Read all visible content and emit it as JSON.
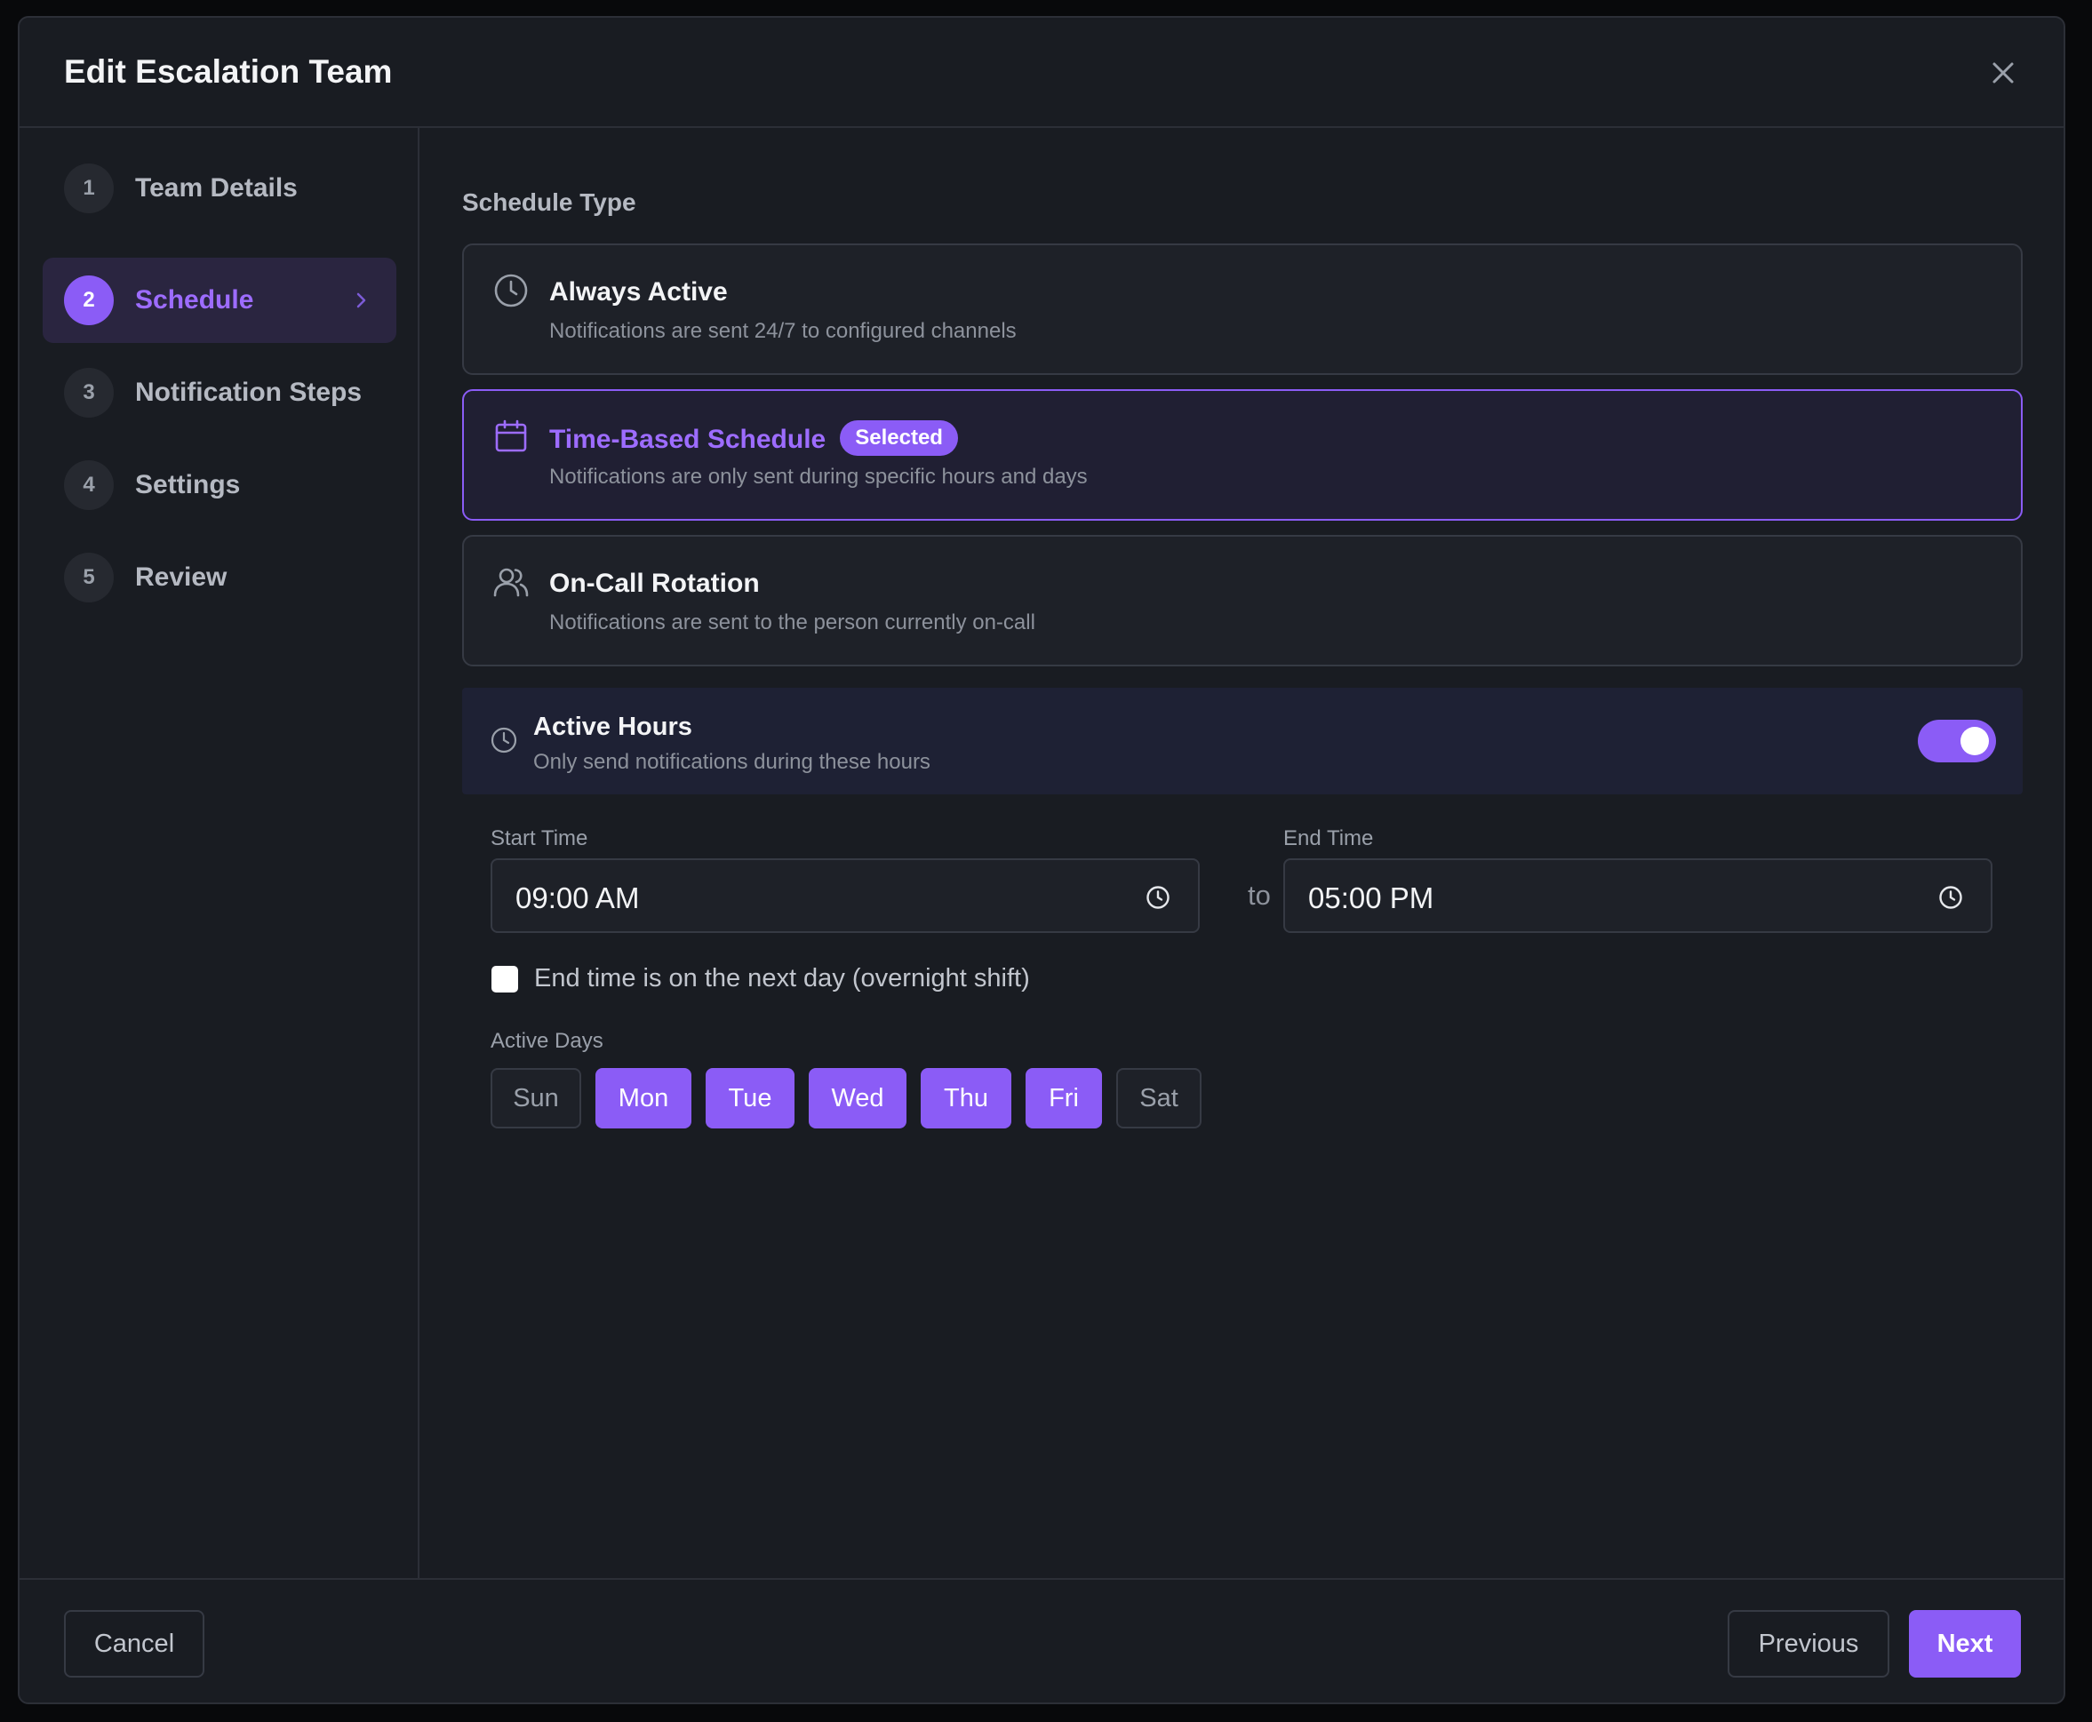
{
  "dialog": {
    "title": "Edit Escalation Team"
  },
  "steps": [
    {
      "num": "1",
      "label": "Team Details"
    },
    {
      "num": "2",
      "label": "Schedule"
    },
    {
      "num": "3",
      "label": "Notification Steps"
    },
    {
      "num": "4",
      "label": "Settings"
    },
    {
      "num": "5",
      "label": "Review"
    }
  ],
  "active_step": "2",
  "schedule": {
    "section_title": "Schedule Type",
    "options": [
      {
        "name": "Always Active",
        "desc": "Notifications are sent 24/7 to configured channels",
        "icon": "clock-icon"
      },
      {
        "name": "Time-Based Schedule",
        "desc": "Notifications are only sent during specific hours and days",
        "icon": "calendar-icon",
        "badge": "Selected"
      },
      {
        "name": "On-Call Rotation",
        "desc": "Notifications are sent to the person currently on-call",
        "icon": "users-icon"
      }
    ],
    "selected": "Time-Based Schedule"
  },
  "active_hours": {
    "title": "Active Hours",
    "desc": "Only send notifications during these hours",
    "enabled": true
  },
  "time": {
    "start_label": "Start Time",
    "start_value": "09:00 AM",
    "separator": "to",
    "end_label": "End Time",
    "end_value": "05:00 PM"
  },
  "overnight": {
    "label": "End time is on the next day (overnight shift)",
    "checked": false
  },
  "days": {
    "label": "Active Days",
    "items": [
      {
        "label": "Sun",
        "active": false
      },
      {
        "label": "Mon",
        "active": true
      },
      {
        "label": "Tue",
        "active": true
      },
      {
        "label": "Wed",
        "active": true
      },
      {
        "label": "Thu",
        "active": true
      },
      {
        "label": "Fri",
        "active": true
      },
      {
        "label": "Sat",
        "active": false
      }
    ]
  },
  "footer": {
    "cancel": "Cancel",
    "previous": "Previous",
    "next": "Next"
  },
  "colors": {
    "accent": "#8b5cf6",
    "accent_text": "#9d6cff",
    "background": "#191c22",
    "border": "#2c2f37"
  }
}
